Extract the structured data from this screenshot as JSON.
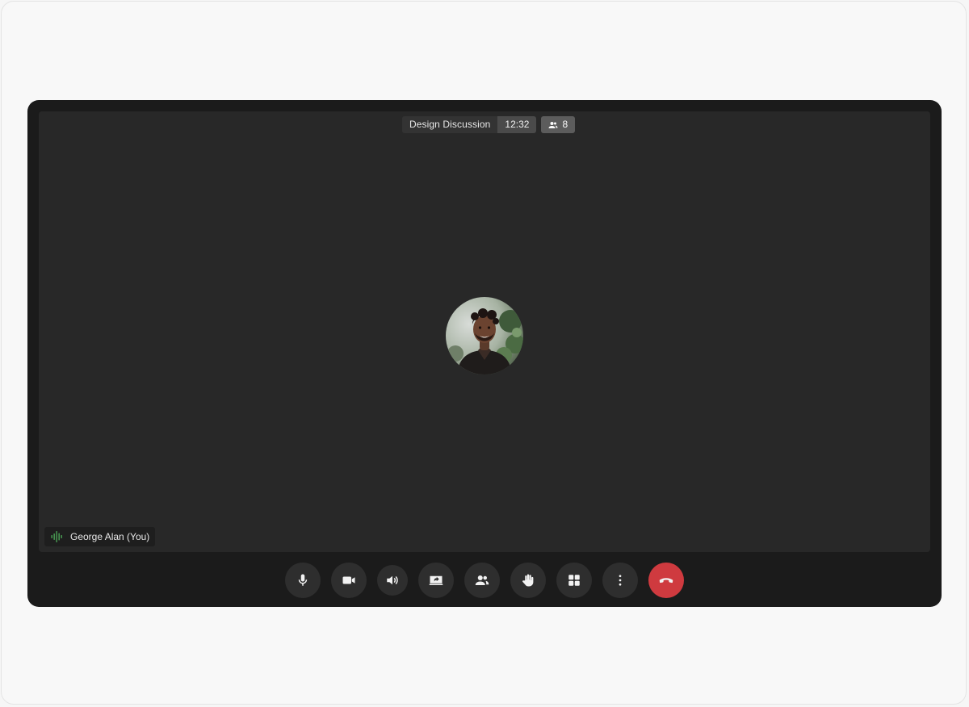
{
  "meeting": {
    "title": "Design Discussion",
    "time": "12:32",
    "participant_count": "8"
  },
  "self_view": {
    "name": "George Alan (You)",
    "speaking": true
  },
  "controls": [
    {
      "name": "microphone",
      "icon": "mic-icon"
    },
    {
      "name": "camera",
      "icon": "video-camera-icon"
    },
    {
      "name": "speaker",
      "icon": "speaker-icon"
    },
    {
      "name": "share-screen",
      "icon": "screen-share-icon"
    },
    {
      "name": "participants",
      "icon": "people-icon"
    },
    {
      "name": "raise-hand",
      "icon": "hand-icon"
    },
    {
      "name": "layout",
      "icon": "grid-icon"
    },
    {
      "name": "more-options",
      "icon": "more-vertical-icon"
    },
    {
      "name": "end-call",
      "icon": "hang-up-icon"
    }
  ],
  "colors": {
    "window_bg": "#1b1b1b",
    "stage_bg": "#282828",
    "end_call": "#cf3a3f",
    "speaking_indicator": "#4fae5a"
  }
}
